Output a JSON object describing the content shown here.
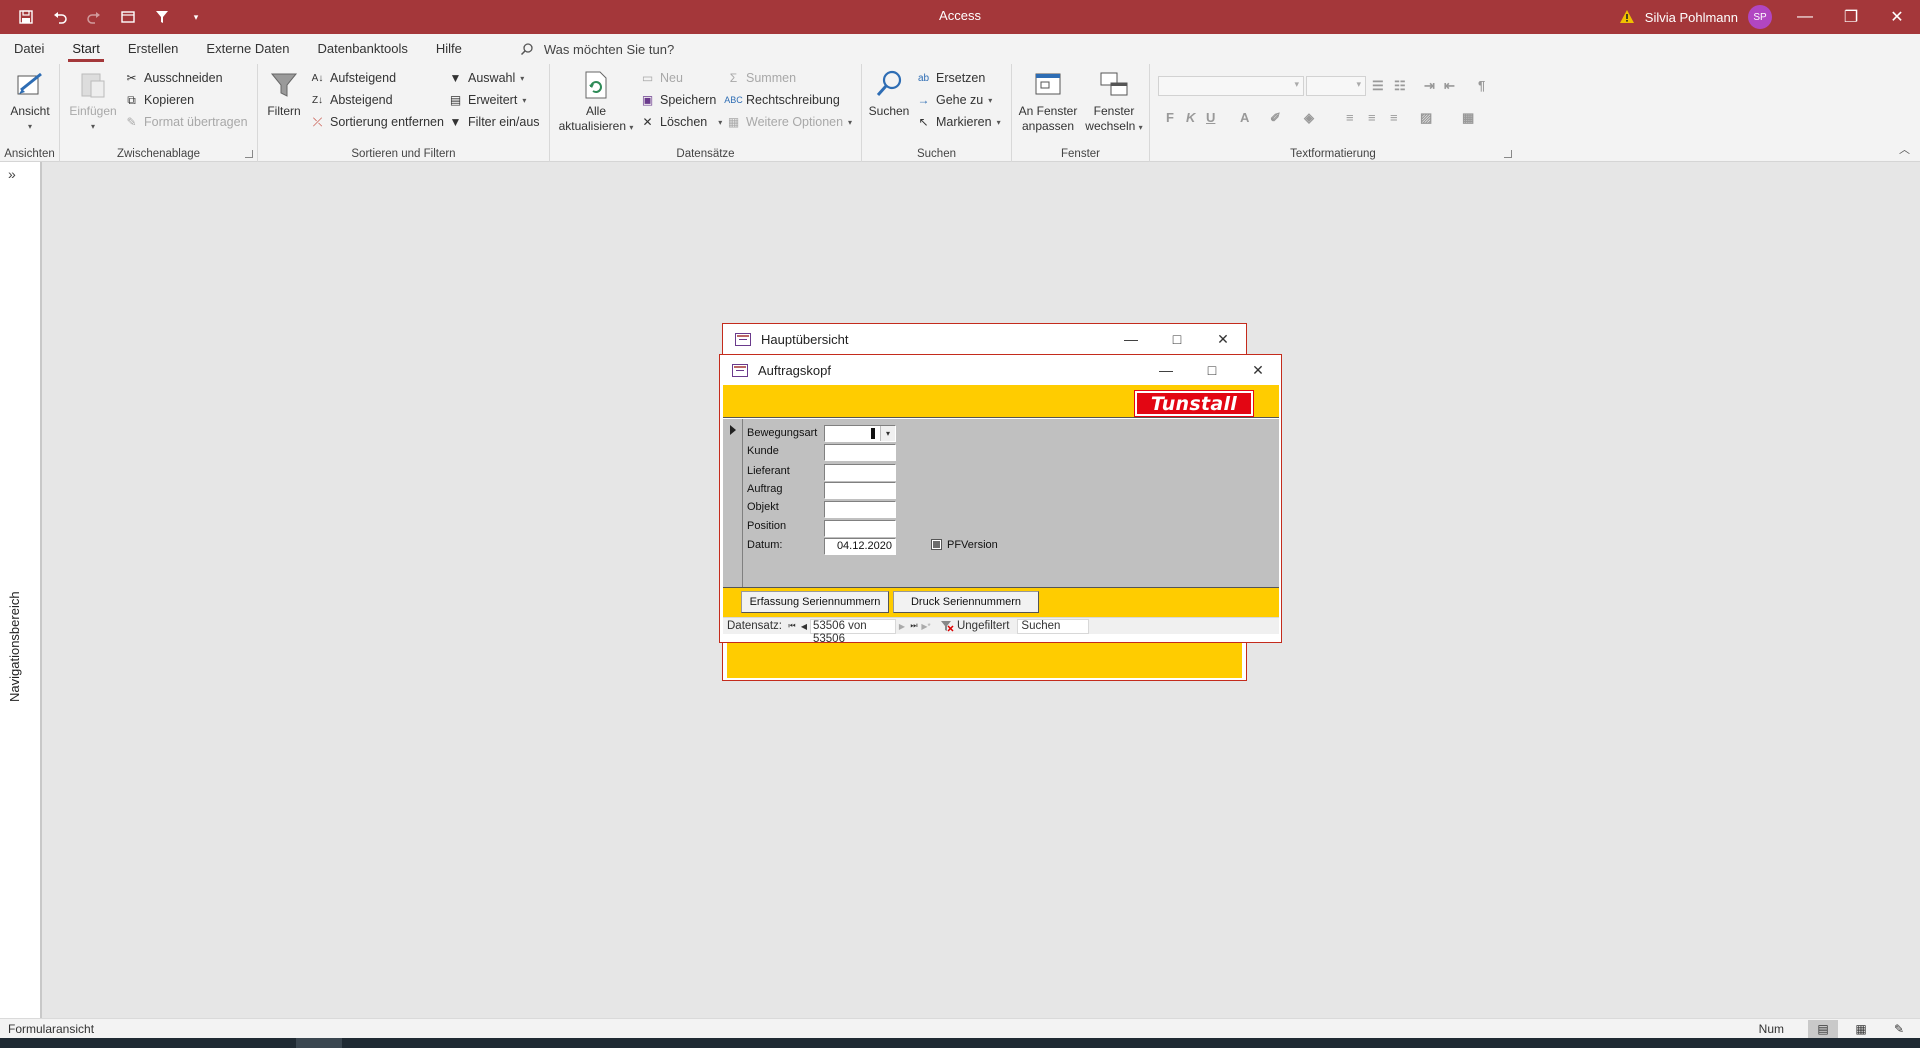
{
  "app": {
    "title": "Access",
    "user_name": "Silvia Pohlmann",
    "user_initials": "SP",
    "accent_color": "#a4373a"
  },
  "quick_access": {
    "icons": [
      "save-icon",
      "undo-icon",
      "redo-icon",
      "view-icon",
      "filter-icon",
      "customize-icon"
    ]
  },
  "window_controls": [
    "minimize",
    "restore",
    "close"
  ],
  "tabs": [
    {
      "label": "Datei"
    },
    {
      "label": "Start",
      "active": true
    },
    {
      "label": "Erstellen"
    },
    {
      "label": "Externe Daten"
    },
    {
      "label": "Datenbanktools"
    },
    {
      "label": "Hilfe"
    }
  ],
  "tell_me": "Was möchten Sie tun?",
  "ribbon": {
    "ansichten": {
      "group": "Ansichten",
      "view": "Ansicht"
    },
    "zwischenablage": {
      "group": "Zwischenablage",
      "paste": "Einfügen",
      "cut": "Ausschneiden",
      "copy": "Kopieren",
      "format_painter": "Format übertragen"
    },
    "sortieren": {
      "group": "Sortieren und Filtern",
      "filter": "Filtern",
      "asc": "Aufsteigend",
      "desc": "Absteigend",
      "remove_sort": "Sortierung entfernen",
      "selection": "Auswahl",
      "advanced": "Erweitert",
      "toggle_filter": "Filter ein/aus"
    },
    "datensaetze": {
      "group": "Datensätze",
      "refresh_line1": "Alle",
      "refresh_line2": "aktualisieren",
      "new": "Neu",
      "save": "Speichern",
      "delete": "Löschen",
      "totals": "Summen",
      "spelling": "Rechtschreibung",
      "more": "Weitere Optionen"
    },
    "suchen": {
      "group": "Suchen",
      "find": "Suchen",
      "replace": "Ersetzen",
      "goto": "Gehe zu",
      "select": "Markieren"
    },
    "fenster": {
      "group": "Fenster",
      "fit_line1": "An Fenster",
      "fit_line2": "anpassen",
      "switch_line1": "Fenster",
      "switch_line2": "wechseln"
    },
    "text": {
      "group": "Textformatierung",
      "bold": "F",
      "italic": "K",
      "underline": "U"
    }
  },
  "nav_pane": {
    "label": "Navigationsbereich"
  },
  "windows": {
    "haupt": {
      "title": "Hauptübersicht"
    },
    "auftrag": {
      "title": "Auftragskopf",
      "logo_text": "Tunstall",
      "colors": {
        "header": "#ffcc00",
        "detail": "#c0c0c0",
        "logo_red": "#e30613"
      },
      "fields": [
        {
          "label": "Bewegungsart",
          "value": ""
        },
        {
          "label": "Kunde",
          "value": ""
        },
        {
          "label": "Lieferant",
          "value": ""
        },
        {
          "label": "Auftrag",
          "value": ""
        },
        {
          "label": "Objekt",
          "value": ""
        },
        {
          "label": "Position",
          "value": ""
        },
        {
          "label": "Datum:",
          "value": "04.12.2020"
        }
      ],
      "checkbox": {
        "label": "PFVersion",
        "checked": "indeterminate"
      },
      "buttons": {
        "erfassung": "Erfassung Seriennummern",
        "druck": "Druck Seriennummern"
      },
      "record_nav": {
        "label": "Datensatz:",
        "position": "53506 von 53506",
        "filter_status": "Ungefiltert",
        "search": "Suchen"
      }
    }
  },
  "status": {
    "mode": "Formularansicht",
    "num": "Num"
  }
}
